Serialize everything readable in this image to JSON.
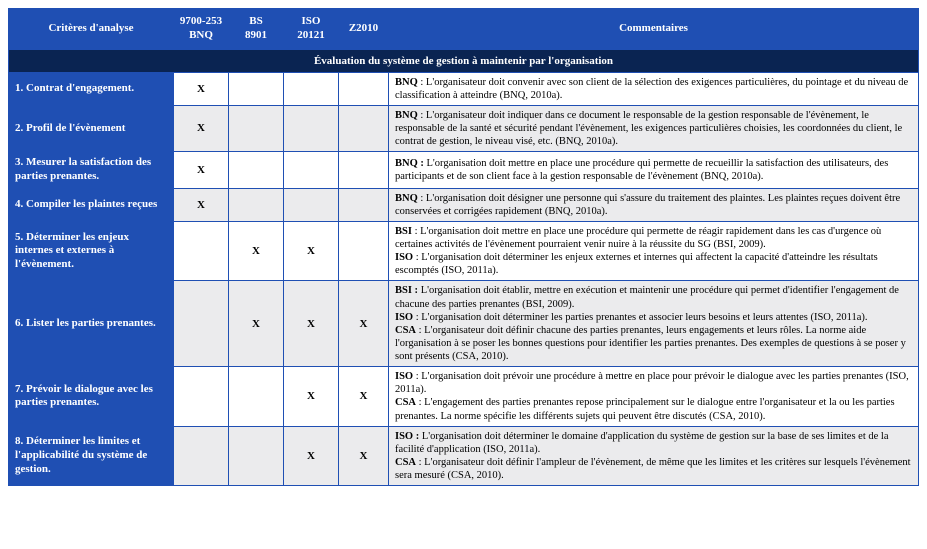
{
  "headers": {
    "criteria": "Critères d'analyse",
    "std1_line1": "9700-253",
    "std1_line2": "BNQ",
    "std2_line1": "BS",
    "std2_line2": "8901",
    "std3_line1": "ISO",
    "std3_line2": "20121",
    "std4": "Z2010",
    "comments": "Commentaires"
  },
  "section_title": "Évaluation du système de gestion à maintenir par l'organisation",
  "mark_char": "X",
  "chart_data": {
    "type": "table",
    "columns": [
      "Critères d'analyse",
      "9700-253 BNQ",
      "BS 8901",
      "ISO 20121",
      "Z2010"
    ],
    "rows": [
      {
        "criterion": "1. Contrat d'engagement.",
        "9700-253 BNQ": true,
        "BS 8901": false,
        "ISO 20121": false,
        "Z2010": false
      },
      {
        "criterion": "2. Profil de l'évènement",
        "9700-253 BNQ": true,
        "BS 8901": false,
        "ISO 20121": false,
        "Z2010": false
      },
      {
        "criterion": "3. Mesurer la satisfaction des parties prenantes.",
        "9700-253 BNQ": true,
        "BS 8901": false,
        "ISO 20121": false,
        "Z2010": false
      },
      {
        "criterion": "4. Compiler les plaintes reçues",
        "9700-253 BNQ": true,
        "BS 8901": false,
        "ISO 20121": false,
        "Z2010": false
      },
      {
        "criterion": "5. Déterminer les enjeux internes et externes à l'évènement.",
        "9700-253 BNQ": false,
        "BS 8901": true,
        "ISO 20121": true,
        "Z2010": false
      },
      {
        "criterion": "6. Lister les parties prenantes.",
        "9700-253 BNQ": false,
        "BS 8901": true,
        "ISO 20121": true,
        "Z2010": true
      },
      {
        "criterion": "7. Prévoir le dialogue avec les parties prenantes.",
        "9700-253 BNQ": false,
        "BS 8901": false,
        "ISO 20121": true,
        "Z2010": true
      },
      {
        "criterion": "8. Déterminer les limites et l'applicabilité du système de gestion.",
        "9700-253 BNQ": false,
        "BS 8901": false,
        "ISO 20121": true,
        "Z2010": true
      }
    ]
  },
  "rows": [
    {
      "criterion": "1. Contrat d'engagement.",
      "marks": [
        "X",
        "",
        "",
        ""
      ],
      "comments": [
        {
          "label": "BNQ",
          "text": " : L'organisateur doit convenir avec son client de la sélection des exigences particulières, du pointage et du niveau de classification à atteindre (BNQ, 2010a)."
        }
      ]
    },
    {
      "criterion": "2. Profil de l'évènement",
      "marks": [
        "X",
        "",
        "",
        ""
      ],
      "comments": [
        {
          "label": "BNQ",
          "text": " : L'organisateur doit indiquer dans ce document le responsable de la gestion responsable de l'évènement, le responsable de la santé et sécurité pendant l'évènement, les exigences particulières choisies, les coordonnées du client, le contrat de gestion, le niveau visé, etc. (BNQ, 2010a)."
        }
      ]
    },
    {
      "criterion": "3. Mesurer la satisfaction des parties prenantes.",
      "marks": [
        "X",
        "",
        "",
        ""
      ],
      "comments": [
        {
          "label": "BNQ :",
          "text": " L'organisation doit mettre en place une procédure qui permette de recueillir la satisfaction des utilisateurs, des participants et de son client face à la gestion responsable de l'évènement (BNQ, 2010a)."
        }
      ]
    },
    {
      "criterion": "4. Compiler les plaintes reçues",
      "marks": [
        "X",
        "",
        "",
        ""
      ],
      "comments": [
        {
          "label": "BNQ",
          "text": " : L'organisation doit désigner une personne qui s'assure du traitement des plaintes. Les plaintes reçues doivent être conservées et corrigées rapidement (BNQ, 2010a)."
        }
      ]
    },
    {
      "criterion": "5. Déterminer les enjeux internes et externes à l'évènement.",
      "marks": [
        "",
        "X",
        "X",
        ""
      ],
      "comments": [
        {
          "label": "BSI",
          "text": " : L'organisation doit mettre en place une procédure qui permette de réagir rapidement dans les cas d'urgence où certaines activités de l'évènement pourraient venir nuire à la réussite du SG (BSI, 2009)."
        },
        {
          "label": "ISO",
          "text": " : L'organisation doit déterminer les enjeux externes et internes qui affectent la capacité d'atteindre les résultats escomptés (ISO, 2011a)."
        }
      ]
    },
    {
      "criterion": "6. Lister les parties prenantes.",
      "marks": [
        "",
        "X",
        "X",
        "X"
      ],
      "comments": [
        {
          "label": "BSI :",
          "text": " L'organisation doit établir, mettre en exécution et maintenir une procédure qui permet d'identifier l'engagement de chacune des parties prenantes (BSI, 2009)."
        },
        {
          "label": "ISO",
          "text": " : L'organisation doit déterminer les parties prenantes et associer leurs besoins et leurs attentes (ISO, 2011a)."
        },
        {
          "label": "CSA",
          "text": " : L'organisateur doit définir chacune des parties prenantes, leurs engagements et leurs rôles. La norme aide l'organisation à se poser les bonnes questions pour identifier les parties prenantes. Des exemples de questions à se poser y sont présents (CSA, 2010)."
        }
      ]
    },
    {
      "criterion": "7. Prévoir le dialogue avec les parties prenantes.",
      "marks": [
        "",
        "",
        "X",
        "X"
      ],
      "comments": [
        {
          "label": "ISO",
          "text": " : L'organisation doit prévoir une procédure à mettre en place pour prévoir le dialogue avec les parties prenantes (ISO, 2011a)."
        },
        {
          "label": "CSA",
          "text": " : L'engagement des parties prenantes repose principalement sur le dialogue entre l'organisateur et la ou les parties prenantes. La norme spécifie les différents sujets qui peuvent être discutés (CSA, 2010)."
        }
      ]
    },
    {
      "criterion": "8. Déterminer les limites et l'applicabilité du système de gestion.",
      "marks": [
        "",
        "",
        "X",
        "X"
      ],
      "comments": [
        {
          "label": "ISO :",
          "text": " L'organisation doit déterminer le domaine d'application du système de gestion sur la base de ses limites et de la facilité d'application (ISO, 2011a)."
        },
        {
          "label": "CSA",
          "text": " : L'organisateur doit définir l'ampleur de l'évènement, de même que les limites et les critères sur lesquels l'évènement sera mesuré (CSA, 2010)."
        }
      ]
    }
  ]
}
